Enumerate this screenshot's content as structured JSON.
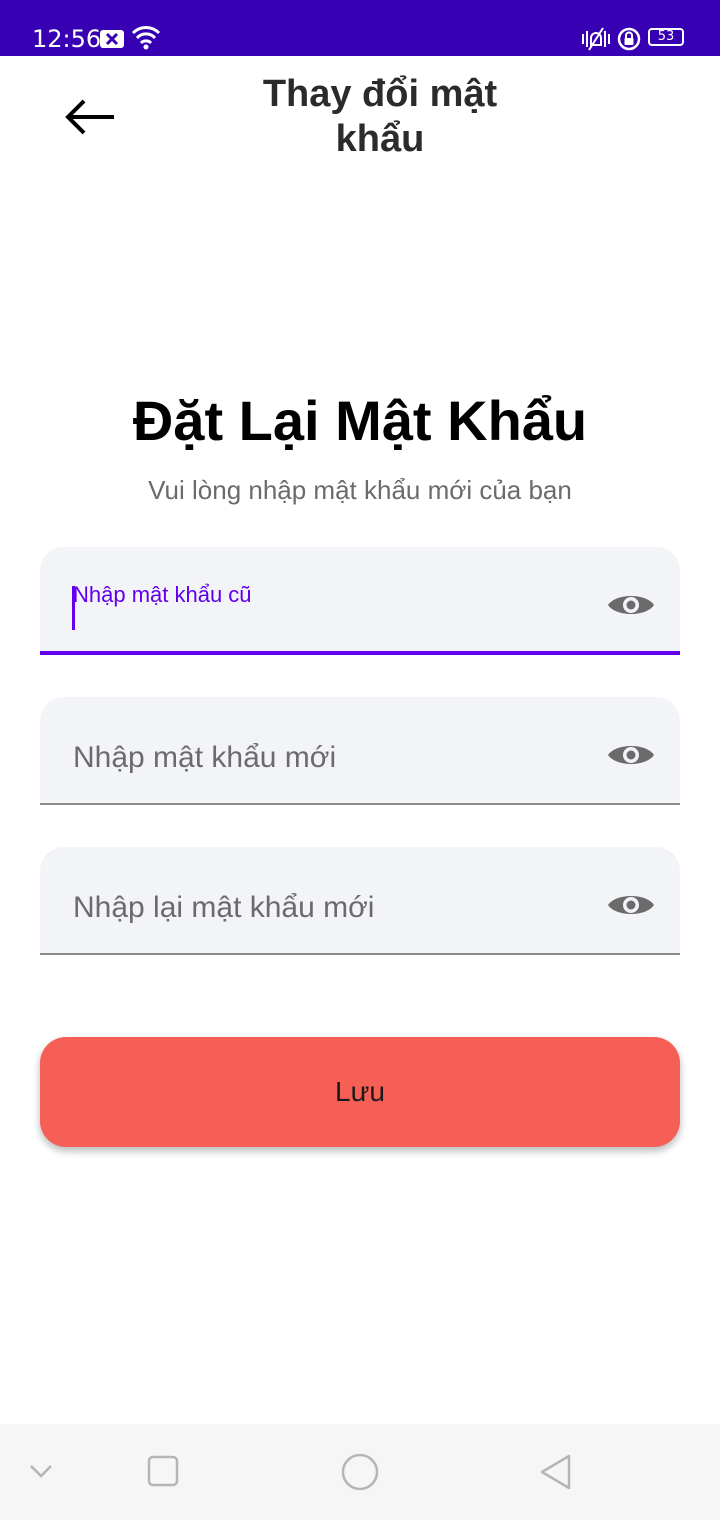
{
  "status_bar": {
    "time": "12:56",
    "battery_level": "53",
    "background_color": "#3700b3",
    "icons": [
      "notification-x-icon",
      "wifi-icon",
      "vibrate-icon",
      "screen-lock-icon",
      "battery-icon"
    ]
  },
  "app_bar": {
    "back_icon": "arrow-left-icon",
    "title_line1": "Thay đổi mật",
    "title_line2": "khẩu"
  },
  "main": {
    "heading": "Đặt Lại Mật Khẩu",
    "subheading": "Vui lòng nhập mật khẩu mới của bạn"
  },
  "form": {
    "fields": [
      {
        "label": "Nhập mật khẩu cũ",
        "value": "",
        "focused": true,
        "icon": "eye-icon"
      },
      {
        "placeholder": "Nhập mật khẩu mới",
        "value": "",
        "focused": false,
        "icon": "eye-icon"
      },
      {
        "placeholder": "Nhập lại mật khẩu mới",
        "value": "",
        "focused": false,
        "icon": "eye-icon"
      }
    ],
    "accent_color": "#6200ee",
    "save_label": "Lưu",
    "save_color": "#f65f55"
  },
  "nav_bar": {
    "icons": [
      "chevron-down-icon",
      "square-recents-icon",
      "circle-home-icon",
      "triangle-back-icon"
    ]
  }
}
